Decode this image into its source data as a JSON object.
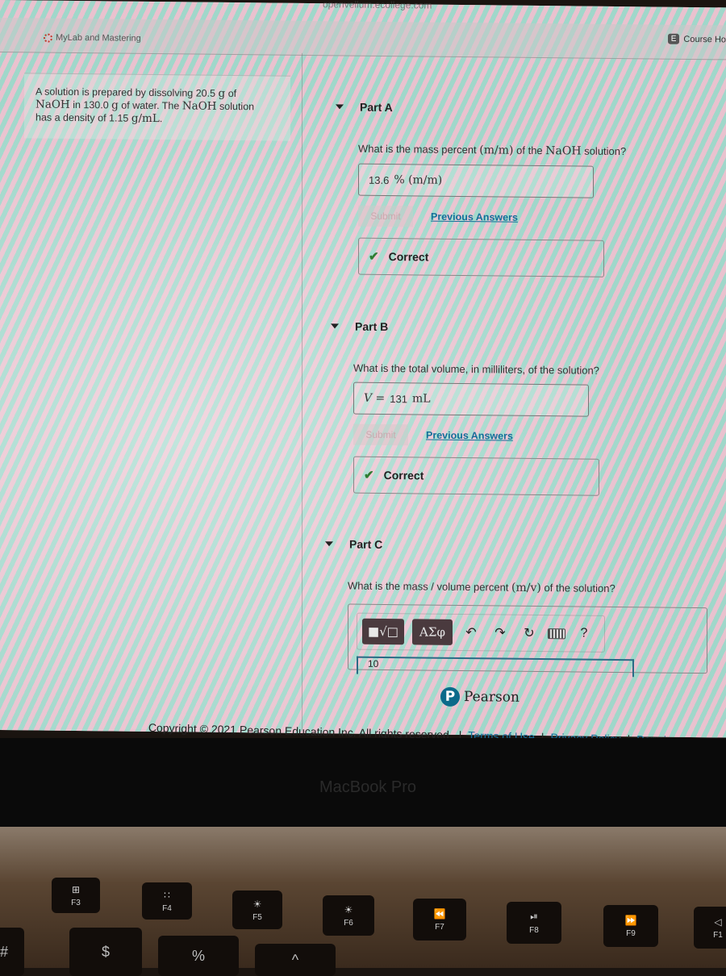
{
  "browser": {
    "url_fragment": "openvellum.ecollege.com",
    "brand": "MyLab and Mastering",
    "course_home_badge": "E",
    "course_home_label": "Course Ho"
  },
  "problem": {
    "line1_a": "A solution is prepared by dissolving 20.5",
    "line1_unit": "g",
    "line1_b": "of",
    "line2_chem": "NaOH",
    "line2_a": "in 130.0",
    "line2_unit": "g",
    "line2_b": "of water. The",
    "line2_chem2": "NaOH",
    "line2_c": "solution",
    "line3_a": "has a density of 1.15",
    "line3_unit": "g/mL",
    "line3_b": "."
  },
  "parts": [
    {
      "label": "Part A",
      "question_a": "What is the mass percent",
      "question_m": "(m/m)",
      "question_b": "of the",
      "question_chem": "NaOH",
      "question_c": "solution?",
      "answer_value": "13.6",
      "answer_unit": "% (m/m)",
      "submit_label": "Submit",
      "previous_answers_label": "Previous Answers",
      "feedback": "Correct"
    },
    {
      "label": "Part B",
      "question": "What is the total volume, in milliliters, of the solution?",
      "answer_var": "V =",
      "answer_value": "131",
      "answer_unit": "mL",
      "submit_label": "Submit",
      "previous_answers_label": "Previous Answers",
      "feedback": "Correct"
    },
    {
      "label": "Part C",
      "question_a": "What is the mass / volume percent",
      "question_m": "(m/v)",
      "question_b": "of the solution?",
      "toolbar": {
        "templates_label": "■√□",
        "symbols_label": "ΑΣφ",
        "undo_icon": "↶",
        "redo_icon": "↷",
        "reset_icon": "↻",
        "help_label": "?"
      },
      "input_partial": "10"
    }
  ],
  "pearson_label": "Pearson",
  "pearson_logo_letter": "P",
  "footer": {
    "copyright": "Copyright © 2021 Pearson Education Inc. All rights reserved.",
    "sep": "|",
    "terms": "Terms of Use",
    "privacy": "Privacy Policy",
    "permissions": "Permis"
  },
  "device_label": "MacBook Pro",
  "keyboard": {
    "fkeys": [
      {
        "label": "F3",
        "icon": "⊞"
      },
      {
        "label": "F4",
        "icon": "∷"
      },
      {
        "label": "F5",
        "icon": "☀"
      },
      {
        "label": "F6",
        "icon": "☀"
      },
      {
        "label": "F7",
        "icon": "⏪"
      },
      {
        "label": "F8",
        "icon": "⏯"
      },
      {
        "label": "F9",
        "icon": "⏩"
      },
      {
        "label": "F1",
        "icon": "◁"
      }
    ],
    "number_row": [
      "#",
      "$",
      "%",
      "^"
    ]
  }
}
